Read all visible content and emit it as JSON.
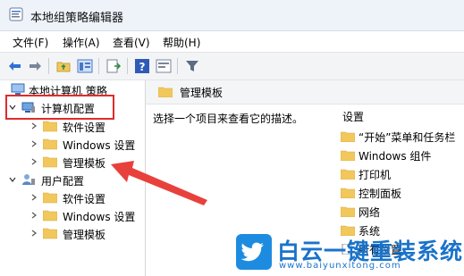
{
  "window": {
    "title": "本地组策略编辑器"
  },
  "menu": [
    {
      "label": "文件(F)"
    },
    {
      "label": "操作(A)"
    },
    {
      "label": "查看(V)"
    },
    {
      "label": "帮助(H)"
    }
  ],
  "tree": {
    "root": "本地计算机 策略",
    "computer_config": "计算机配置",
    "computer_children": [
      "软件设置",
      "Windows 设置",
      "管理模板"
    ],
    "user_config": "用户配置",
    "user_children": [
      "软件设置",
      "Windows 设置",
      "管理模板"
    ]
  },
  "right_pane": {
    "header": "管理模板",
    "description": "选择一个项目来查看它的描述。",
    "column_header": "设置",
    "items": [
      "“开始”菜单和任务栏",
      "Windows 组件",
      "打印机",
      "控制面板",
      "网络",
      "系统",
      "所有设置"
    ]
  },
  "watermark": {
    "title": "白云一键重装系统",
    "url": "www.baiyunxitong.com"
  },
  "colors": {
    "highlight": "#e02b2b",
    "folder": "#f2c75c",
    "accent": "#1a73c9"
  }
}
